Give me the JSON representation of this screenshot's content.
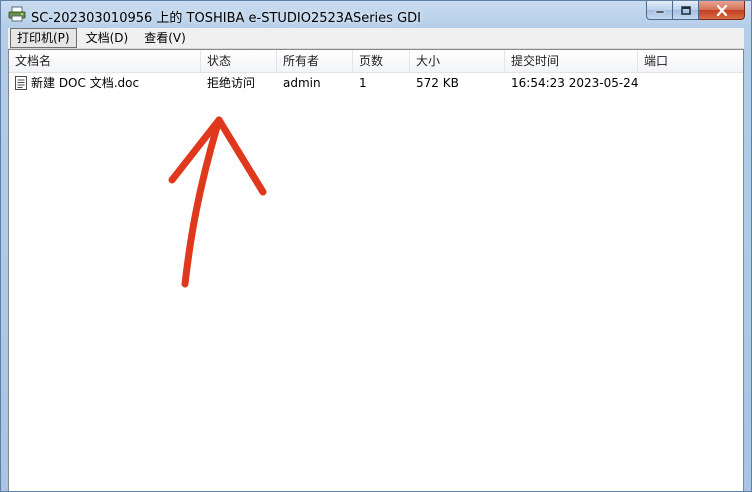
{
  "window": {
    "title": "SC-202303010956 上的 TOSHIBA e-STUDIO2523ASeries GDI"
  },
  "menu": [
    {
      "label": "打印机(P)"
    },
    {
      "label": "文档(D)"
    },
    {
      "label": "查看(V)"
    }
  ],
  "columns": [
    "文档名",
    "状态",
    "所有者",
    "页数",
    "大小",
    "提交时间",
    "端口"
  ],
  "jobs": [
    {
      "name": "新建 DOC 文档.doc",
      "status": "拒绝访问",
      "owner": "admin",
      "pages": "1",
      "size": "572 KB",
      "submitted": "16:54:23  2023-05-24",
      "port": ""
    }
  ],
  "colors": {
    "arrow": "#e0381c",
    "titlebar": "#b4cde8"
  }
}
